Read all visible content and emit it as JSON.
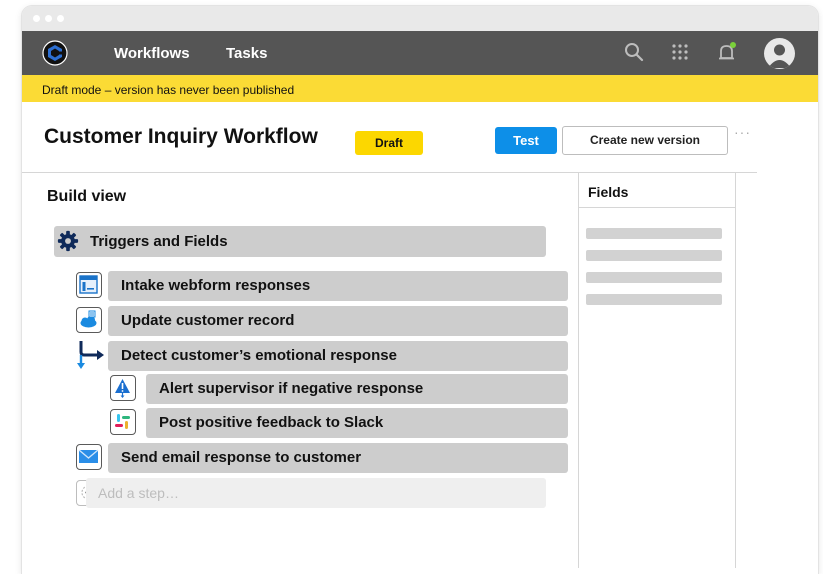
{
  "nav": {
    "items": [
      "Workflows",
      "Tasks"
    ]
  },
  "banner": {
    "text": "Draft mode – version has never been published"
  },
  "header": {
    "title": "Customer Inquiry Workflow",
    "status_badge": "Draft",
    "test_label": "Test",
    "create_label": "Create new version",
    "more_label": "···"
  },
  "build": {
    "title": "Build view",
    "trigger_label": "Triggers and Fields",
    "steps": [
      {
        "label": "Intake webform responses",
        "icon": "webform-icon"
      },
      {
        "label": "Update customer record",
        "icon": "cloud-icon"
      },
      {
        "label": "Detect customer’s emotional response",
        "icon": "branch-arrow-icon"
      },
      {
        "label": "Alert supervisor if negative response",
        "icon": "alert-icon"
      },
      {
        "label": "Post positive feedback to Slack",
        "icon": "slack-icon"
      },
      {
        "label": "Send email response to customer",
        "icon": "mail-icon"
      }
    ],
    "add_placeholder": "Add a step…"
  },
  "fields": {
    "title": "Fields"
  },
  "colors": {
    "accent": "#0d8fe8",
    "banner": "#fbdb35",
    "navbar": "#555555",
    "draft": "#fcd700"
  }
}
